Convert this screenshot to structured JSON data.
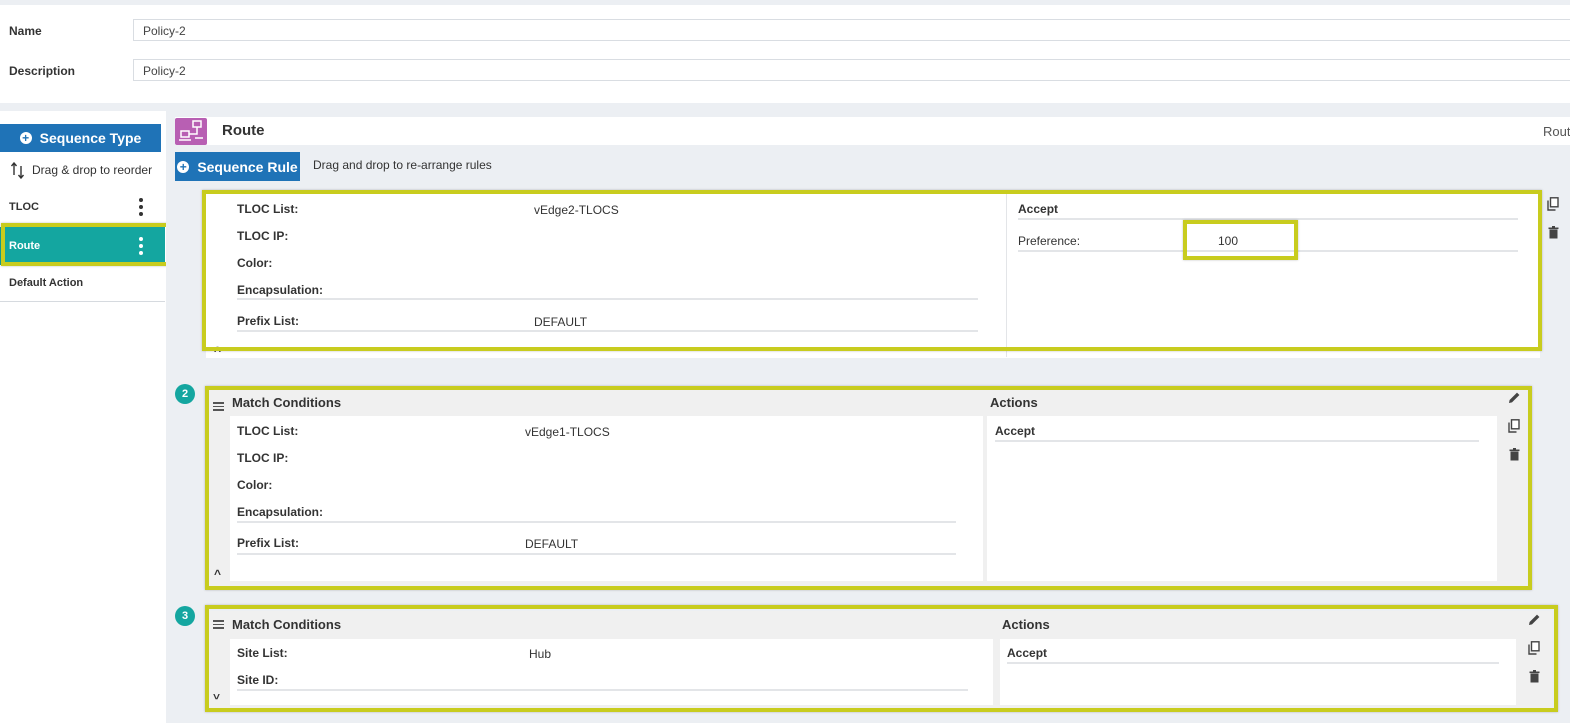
{
  "form": {
    "name_label": "Name",
    "name_value": "Policy-2",
    "description_label": "Description",
    "description_value": "Policy-2"
  },
  "sidebar": {
    "sequence_type_button": "Sequence Type",
    "reorder_hint": "Drag & drop to reorder",
    "items": [
      {
        "label": "TLOC"
      },
      {
        "label": "Route"
      },
      {
        "label": "Default Action"
      }
    ]
  },
  "main": {
    "title": "Route",
    "title_right_truncated": "Rout",
    "sequence_rule_button": "Sequence Rule",
    "rearrange_hint": "Drag and drop to re-arrange rules"
  },
  "rules": [
    {
      "conditions": [
        {
          "label": "TLOC List:",
          "value": "vEdge2-TLOCS"
        },
        {
          "label": "TLOC IP:",
          "value": ""
        },
        {
          "label": "Color:",
          "value": ""
        },
        {
          "label": "Encapsulation:",
          "value": ""
        },
        {
          "label": "Prefix List:",
          "value": "DEFAULT"
        }
      ],
      "action": "Accept",
      "preference_label": "Preference:",
      "preference_value": "100"
    },
    {
      "number": "2",
      "match_header": "Match Conditions",
      "actions_header": "Actions",
      "conditions": [
        {
          "label": "TLOC List:",
          "value": "vEdge1-TLOCS"
        },
        {
          "label": "TLOC IP:",
          "value": ""
        },
        {
          "label": "Color:",
          "value": ""
        },
        {
          "label": "Encapsulation:",
          "value": ""
        },
        {
          "label": "Prefix List:",
          "value": "DEFAULT"
        }
      ],
      "action": "Accept"
    },
    {
      "number": "3",
      "match_header": "Match Conditions",
      "actions_header": "Actions",
      "conditions": [
        {
          "label": "Site List:",
          "value": "Hub"
        },
        {
          "label": "Site ID:",
          "value": ""
        }
      ],
      "action": "Accept"
    }
  ],
  "icons": {
    "add": "plus-circle-icon",
    "reorder": "swap-vertical-icon",
    "more": "kebab-menu-icon",
    "route": "network-route-icon",
    "drag": "drag-handle-icon",
    "collapse": "chevron-up-icon",
    "expand": "chevron-down-icon",
    "edit": "pencil-icon",
    "copy": "copy-icon",
    "delete": "trash-icon"
  },
  "colors": {
    "primary": "#1f73b7",
    "selected": "#14a6a0",
    "highlight": "#c8cc1e",
    "route_icon": "#b85fb3",
    "badge": "#14a6a0"
  }
}
